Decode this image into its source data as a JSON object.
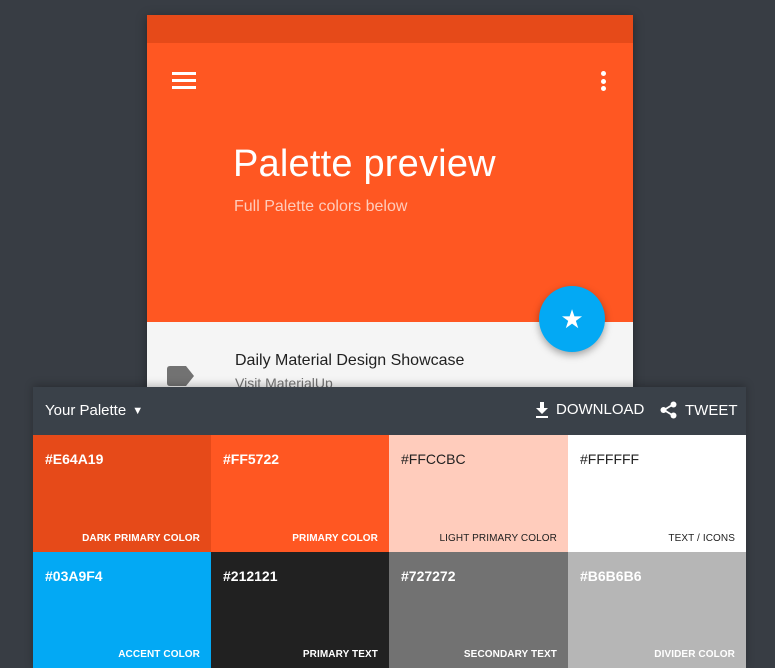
{
  "preview": {
    "title": "Palette preview",
    "subtitle": "Full Palette colors below",
    "list_item": {
      "title": "Daily Material Design Showcase",
      "subtitle": "Visit MaterialUp"
    },
    "icons": {
      "menu": "hamburger-menu-icon",
      "more": "more-vert-icon",
      "fab": "star-icon",
      "list": "label-tag-icon"
    }
  },
  "panel": {
    "palette_label": "Your Palette",
    "download_label": "DOWNLOAD",
    "tweet_label": "TWEET",
    "swatches": [
      {
        "hex": "#E64A19",
        "label": "DARK PRIMARY COLOR",
        "bg": "#e64a19",
        "fg": "#ffffff"
      },
      {
        "hex": "#FF5722",
        "label": "PRIMARY COLOR",
        "bg": "#ff5722",
        "fg": "#ffffff"
      },
      {
        "hex": "#FFCCBC",
        "label": "LIGHT PRIMARY COLOR",
        "bg": "#ffccbc",
        "fg": "#212121"
      },
      {
        "hex": "#FFFFFF",
        "label": "TEXT / ICONS",
        "bg": "#ffffff",
        "fg": "#212121"
      },
      {
        "hex": "#03A9F4",
        "label": "ACCENT COLOR",
        "bg": "#03a9f4",
        "fg": "#ffffff"
      },
      {
        "hex": "#212121",
        "label": "PRIMARY TEXT",
        "bg": "#212121",
        "fg": "#ffffff"
      },
      {
        "hex": "#727272",
        "label": "SECONDARY TEXT",
        "bg": "#727272",
        "fg": "#ffffff"
      },
      {
        "hex": "#B6B6B6",
        "label": "DIVIDER COLOR",
        "bg": "#b6b6b6",
        "fg": "#ffffff"
      }
    ]
  }
}
